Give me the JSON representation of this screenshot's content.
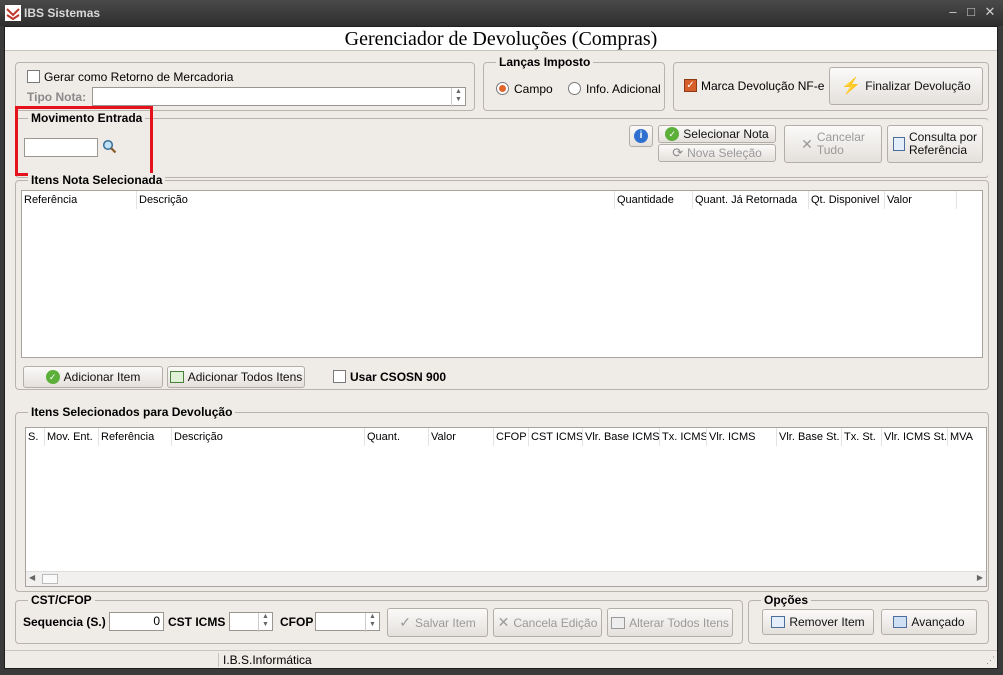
{
  "app": {
    "title": "IBS Sistemas"
  },
  "header": {
    "title": "Gerenciador de Devoluções (Compras)"
  },
  "top": {
    "gerar_retorno_label": "Gerar como Retorno de Mercadoria",
    "tipo_nota_label": "Tipo Nota:",
    "tipo_nota_value": "",
    "lancas_imposto_title": "Lanças Imposto",
    "radio_campo": "Campo",
    "radio_info": "Info. Adicional",
    "marca_devolucao_label": "Marca Devolução NF-e",
    "finalizar_label": "Finalizar Devolução"
  },
  "movimento": {
    "title": "Movimento Entrada",
    "value": ""
  },
  "actions": {
    "selecionar_nota": "Selecionar Nota",
    "nova_selecao": "Nova Seleção",
    "cancelar_tudo_1": "Cancelar",
    "cancelar_tudo_2": "Tudo",
    "consulta_1": "Consulta por",
    "consulta_2": "Referência"
  },
  "itens_nota": {
    "title": "Itens Nota Selecionada",
    "columns": [
      "Referência",
      "Descrição",
      "Quantidade",
      "Quant. Já Retornada",
      "Qt. Disponivel",
      "Valor"
    ],
    "adicionar_item": "Adicionar Item",
    "adicionar_todos": "Adicionar Todos Itens",
    "usar_csosn": "Usar CSOSN 900"
  },
  "itens_devolucao": {
    "title": "Itens Selecionados para Devolução",
    "columns": [
      "S.",
      "Mov. Ent.",
      "Referência",
      "Descrição",
      "Quant.",
      "Valor",
      "CFOP",
      "CST ICMS",
      "Vlr. Base ICMS",
      "Tx. ICMS",
      "Vlr. ICMS",
      "Vlr. Base St.",
      "Tx. St.",
      "Vlr. ICMS St.",
      "MVA"
    ]
  },
  "cst": {
    "title": "CST/CFOP",
    "sequencia_label": "Sequencia (S.)",
    "sequencia_value": "0",
    "cst_icms_label": "CST ICMS",
    "cfop_label": "CFOP",
    "salvar_item": "Salvar Item",
    "cancela_edicao": "Cancela Edição",
    "alterar_todos": "Alterar Todos Itens"
  },
  "opcoes": {
    "title": "Opções",
    "remover_item": "Remover Item",
    "avancado": "Avançado"
  },
  "status": {
    "company": "I.B.S.Informática"
  },
  "colors": {
    "highlight": "#e5121e",
    "accent": "#e0662c",
    "background": "#efebe7"
  }
}
